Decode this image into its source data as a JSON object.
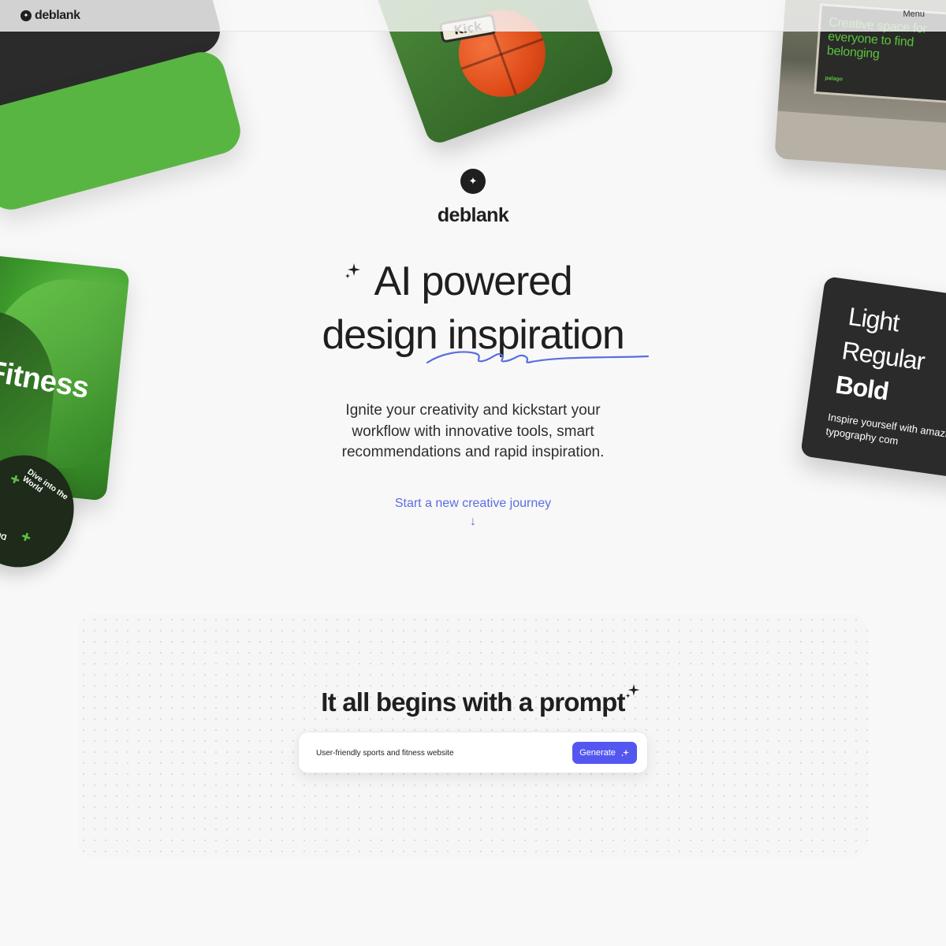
{
  "nav": {
    "logo_text": "deblank",
    "menu_label": "Menu"
  },
  "hero": {
    "logo_text": "deblank",
    "headline_line1": "AI powered",
    "headline_line2": "design inspiration",
    "subtitle": "Ignite your creativity and kickstart your workflow with innovative tools, smart recommendations and rapid inspiration.",
    "cta_label": "Start a new creative journey",
    "cta_arrow": "↓",
    "accent_color": "#5a6ee0"
  },
  "showcase_cards": {
    "basketball_tag": "Kick",
    "billboard_text": "Creative space for everyone to find belonging",
    "billboard_brand": "palago",
    "fitness_text": "Fitness",
    "badge_text_top": "Dive into the World",
    "badge_text_bottom": "Dive i",
    "typography_light": "Light",
    "typography_regular": "Regular",
    "typography_bold": "Bold",
    "typography_note": "Inspire yourself with amazing typography com"
  },
  "prompt_section": {
    "title": "It all begins with a prompt",
    "input_value": "User-friendly sports and fitness website",
    "generate_label": "Generate",
    "button_color": "#5457ef"
  },
  "icons": {
    "logo": "circle-sparkle-icon",
    "sparkle": "sparkle-icon"
  }
}
